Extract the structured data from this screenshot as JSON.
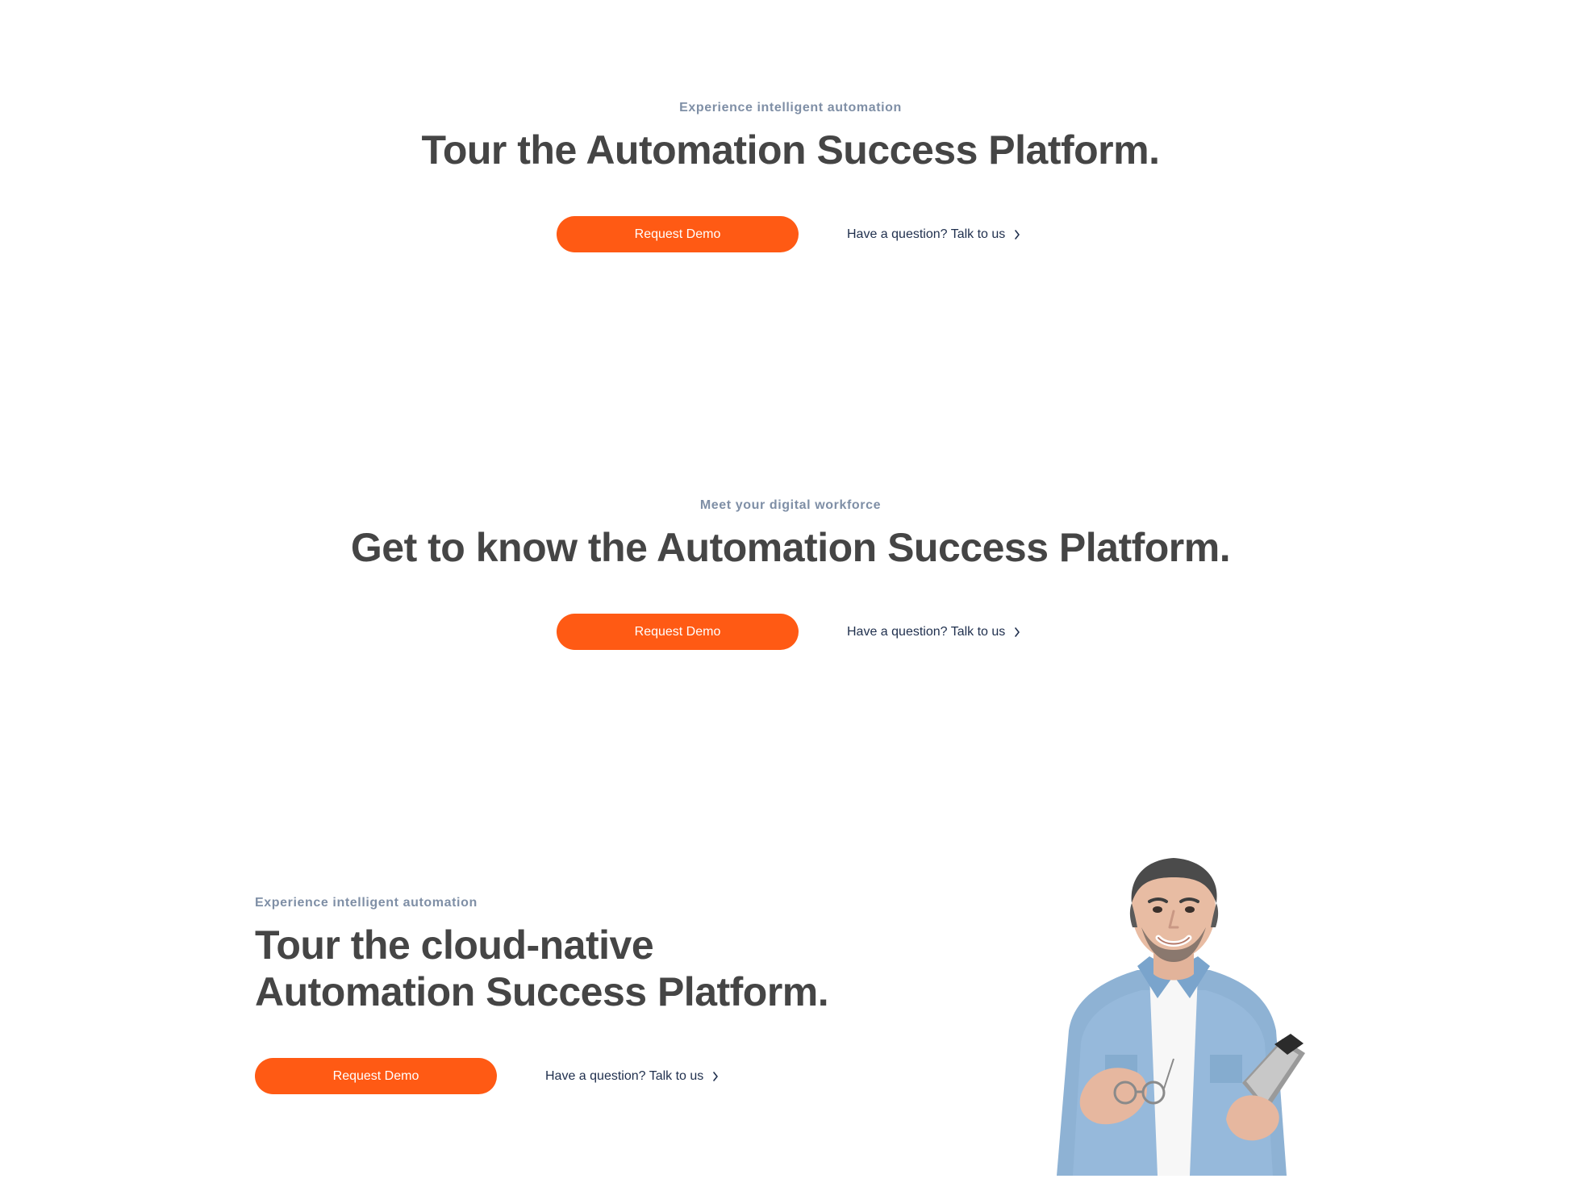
{
  "colors": {
    "accent": "#ff5a14",
    "heading": "#454545",
    "eyebrow": "#7f8fa6",
    "link": "#1f2f4d",
    "background": "#ffffff"
  },
  "sections": [
    {
      "eyebrow": "Experience intelligent automation",
      "headline": "Tour the Automation Success Platform.",
      "primary_cta": "Request Demo",
      "secondary_cta": "Have a question? Talk to us",
      "secondary_icon": "chevron-right-icon"
    },
    {
      "eyebrow": "Meet your digital workforce",
      "headline": "Get to know the Automation Success Platform.",
      "primary_cta": "Request Demo",
      "secondary_cta": "Have a question? Talk to us",
      "secondary_icon": "chevron-right-icon"
    },
    {
      "eyebrow": "Experience intelligent automation",
      "headline_lines": [
        "Tour the cloud-native",
        "Automation Success Platform."
      ],
      "primary_cta": "Request Demo",
      "secondary_cta": "Have a question? Talk to us",
      "secondary_icon": "chevron-right-icon",
      "image": "person-with-tablet-illustration"
    }
  ]
}
